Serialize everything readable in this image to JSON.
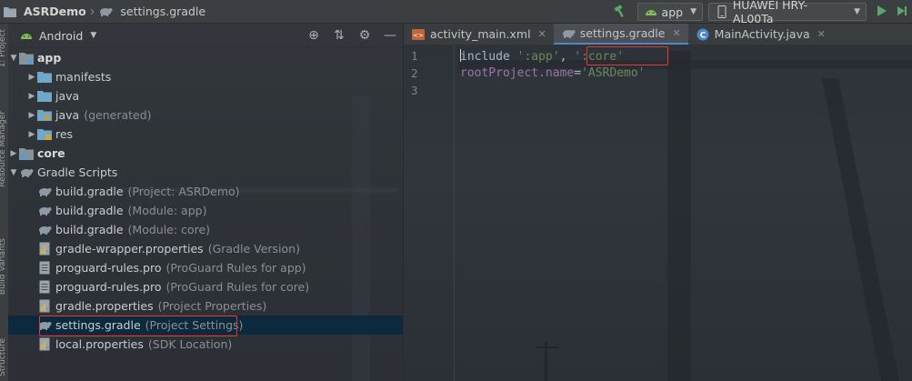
{
  "breadcrumb": {
    "project": "ASRDemo",
    "file": "settings.gradle"
  },
  "toolbar": {
    "config_label": "app",
    "device_label": "HUAWEI HRY-AL00Ta"
  },
  "side_strip": {
    "top_label": "1: Project",
    "middle_label": "Resource Manager",
    "lower_label": "Build Variants",
    "bottom_label": "Structure"
  },
  "project_panel": {
    "view_label": "Android",
    "tree": [
      {
        "name": "app",
        "hint": "",
        "icon": "module-folder-icon",
        "bold": true
      },
      {
        "name": "manifests",
        "hint": "",
        "icon": "folder-icon"
      },
      {
        "name": "java",
        "hint": "",
        "icon": "folder-icon"
      },
      {
        "name": "java",
        "hint": "(generated)",
        "icon": "folder-icon"
      },
      {
        "name": "res",
        "hint": "",
        "icon": "folder-icon"
      },
      {
        "name": "core",
        "hint": "",
        "icon": "module-folder-icon",
        "bold": true
      },
      {
        "name": "Gradle Scripts",
        "hint": "",
        "icon": "gradle-icon"
      },
      {
        "name": "build.gradle",
        "hint": "(Project: ASRDemo)",
        "icon": "gradle-icon"
      },
      {
        "name": "build.gradle",
        "hint": "(Module: app)",
        "icon": "gradle-icon"
      },
      {
        "name": "build.gradle",
        "hint": "(Module: core)",
        "icon": "gradle-icon"
      },
      {
        "name": "gradle-wrapper.properties",
        "hint": "(Gradle Version)",
        "icon": "properties-icon"
      },
      {
        "name": "proguard-rules.pro",
        "hint": "(ProGuard Rules for app)",
        "icon": "text-file-icon"
      },
      {
        "name": "proguard-rules.pro",
        "hint": "(ProGuard Rules for core)",
        "icon": "text-file-icon"
      },
      {
        "name": "gradle.properties",
        "hint": "(Project Properties)",
        "icon": "properties-icon"
      },
      {
        "name": "settings.gradle",
        "hint": "(Project Settings)",
        "icon": "gradle-icon",
        "selected": true
      },
      {
        "name": "local.properties",
        "hint": "(SDK Location)",
        "icon": "properties-icon"
      }
    ]
  },
  "editor": {
    "tabs": [
      {
        "label": "activity_main.xml",
        "icon": "xml-file-icon",
        "active": false
      },
      {
        "label": "settings.gradle",
        "icon": "gradle-icon",
        "active": true
      },
      {
        "label": "MainActivity.java",
        "icon": "java-class-icon",
        "active": false
      }
    ],
    "line_numbers": [
      "1",
      "2",
      "3"
    ],
    "code": {
      "line1_keyword": "include",
      "line1_str1": "':app'",
      "line1_comma": ", ",
      "line1_str2": "':core'",
      "line2_ident": "rootProject.name",
      "line2_eq": "=",
      "line2_str": "'ASRDemo'"
    }
  },
  "colors": {
    "accent": "#4a88c7",
    "selection": "#0d293e",
    "highlight_box": "#e03b3b",
    "string": "#6a8759",
    "identifier": "#9876aa"
  }
}
